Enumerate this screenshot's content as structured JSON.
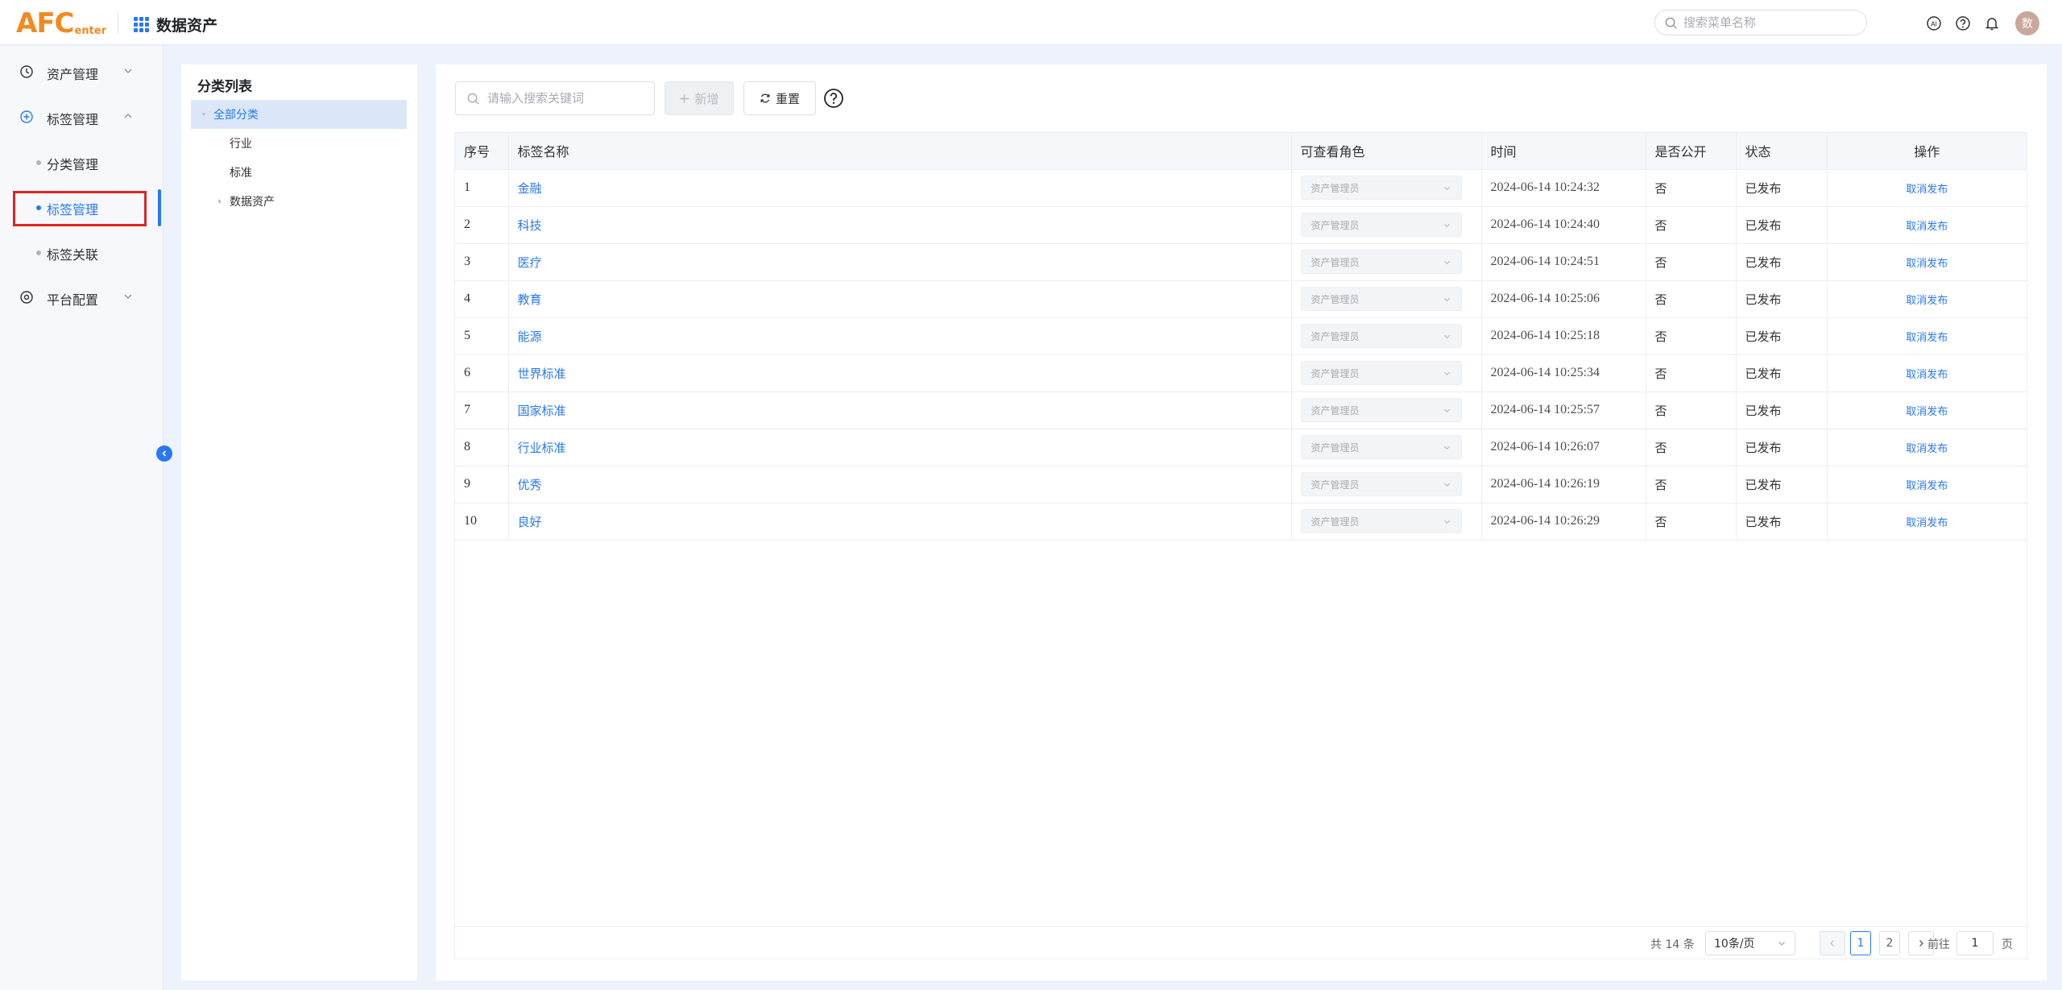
{
  "header": {
    "logo_big": "AFC",
    "logo_small": "enter",
    "app_title": "数据资产",
    "menu_search_placeholder": "搜索菜单名称",
    "avatar_text": "数"
  },
  "sidebar": {
    "items": [
      {
        "label": "资产管理"
      },
      {
        "label": "标签管理"
      },
      {
        "label": "分类管理"
      },
      {
        "label": "标签管理"
      },
      {
        "label": "标签关联"
      },
      {
        "label": "平台配置"
      }
    ]
  },
  "category": {
    "title": "分类列表",
    "root": "全部分类",
    "children": [
      "行业",
      "标准",
      "数据资产"
    ]
  },
  "toolbar": {
    "search_placeholder": "请输入搜索关键词",
    "add_label": "新增",
    "reset_label": "重置"
  },
  "table": {
    "headers": [
      "序号",
      "标签名称",
      "可查看角色",
      "时间",
      "是否公开",
      "状态",
      "操作"
    ],
    "rows": [
      {
        "seq": "1",
        "name": "金融",
        "role": "资产管理员",
        "time": "2024-06-14 10:24:32",
        "public": "否",
        "status": "已发布",
        "action": "取消发布"
      },
      {
        "seq": "2",
        "name": "科技",
        "role": "资产管理员",
        "time": "2024-06-14 10:24:40",
        "public": "否",
        "status": "已发布",
        "action": "取消发布"
      },
      {
        "seq": "3",
        "name": "医疗",
        "role": "资产管理员",
        "time": "2024-06-14 10:24:51",
        "public": "否",
        "status": "已发布",
        "action": "取消发布"
      },
      {
        "seq": "4",
        "name": "教育",
        "role": "资产管理员",
        "time": "2024-06-14 10:25:06",
        "public": "否",
        "status": "已发布",
        "action": "取消发布"
      },
      {
        "seq": "5",
        "name": "能源",
        "role": "资产管理员",
        "time": "2024-06-14 10:25:18",
        "public": "否",
        "status": "已发布",
        "action": "取消发布"
      },
      {
        "seq": "6",
        "name": "世界标准",
        "role": "资产管理员",
        "time": "2024-06-14 10:25:34",
        "public": "否",
        "status": "已发布",
        "action": "取消发布"
      },
      {
        "seq": "7",
        "name": "国家标准",
        "role": "资产管理员",
        "time": "2024-06-14 10:25:57",
        "public": "否",
        "status": "已发布",
        "action": "取消发布"
      },
      {
        "seq": "8",
        "name": "行业标准",
        "role": "资产管理员",
        "time": "2024-06-14 10:26:07",
        "public": "否",
        "status": "已发布",
        "action": "取消发布"
      },
      {
        "seq": "9",
        "name": "优秀",
        "role": "资产管理员",
        "time": "2024-06-14 10:26:19",
        "public": "否",
        "status": "已发布",
        "action": "取消发布"
      },
      {
        "seq": "10",
        "name": "良好",
        "role": "资产管理员",
        "time": "2024-06-14 10:26:29",
        "public": "否",
        "status": "已发布",
        "action": "取消发布"
      }
    ]
  },
  "pagination": {
    "total": "共 14 条",
    "page_size": "10条/页",
    "pages": [
      "1",
      "2"
    ],
    "goto_label": "前往",
    "goto_value": "1",
    "unit": "页"
  },
  "colors": {
    "accent": "#2878f0",
    "logo": "#f08a22",
    "highlight": "#e02424"
  }
}
